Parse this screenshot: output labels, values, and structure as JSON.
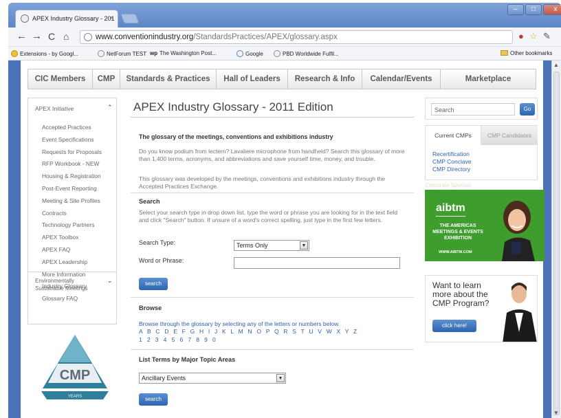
{
  "browser": {
    "tab_title": "APEX Industry Glossary - 201",
    "tab_close": "×",
    "url_domain": "www.conventionindustry.org",
    "url_path": "/StandardsPractices/APEX/glossary.aspx",
    "bookmarks": [
      "Extensions - by Googl...",
      "NetForum TEST",
      "The Washington Post...",
      "Google",
      "PBD Worldwide Fulfil..."
    ],
    "other_bookmarks": "Other bookmarks",
    "nav_icons": [
      "back-arrow",
      "forward-arrow",
      "reload",
      "home"
    ]
  },
  "topnav": {
    "items": [
      "CIC Members",
      "CMP",
      "Standards & Practices",
      "Hall of Leaders",
      "Research & Info",
      "Calendar/Events",
      "Marketplace"
    ]
  },
  "sidebar": {
    "heading": "APEX Initiative",
    "items": [
      "Accepted Practices",
      "Event Specifications",
      "Requests for Proposals",
      "RFP Workbook - NEW",
      "Housing & Registration",
      "Post-Event Reporting",
      "Meeting & Site Profiles",
      "Contracts",
      "Technology Partners",
      "APEX Toolbox",
      "APEX FAQ",
      "APEX Leadership",
      "More Information",
      "Industry Glossary",
      "Glossary FAQ"
    ],
    "env_line1": "Environmentally",
    "env_line2": "Sustainable Meetings"
  },
  "logo": {
    "text": "CMP",
    "ribbon": "YEARS"
  },
  "main": {
    "title": "APEX Industry Glossary - 2011 Edition",
    "intro_heading": "The glossary of the meetings, conventions and exhibitions industry",
    "intro_p1": "Do you know podium from lectern? Lavaliere microphone from handheld? Search this glossary of more than 1,400 terms, acronyms, and abbreviations and save yourself time, money, and trouble.",
    "intro_p2": "This glossary was developed by the meetings, conventions and exhibitions industry through the Accepted Practices Exchange.",
    "search_heading": "Search",
    "search_desc": "Select your search type in drop down list, type the word or phrase you are looking for in the text field and click \"Search\" button. If unsure of a word's correct spelling, just type in the first few letters.",
    "search_type_label": "Search Type:",
    "search_type_value": "Terms Only",
    "word_label": "Word or Phrase:",
    "search_button": "search",
    "browse_heading": "Browse",
    "browse_desc": "Browse through the glossary by selecting any of the letters or numbers below.",
    "letters": "A B C D E F G H I J K L M N O P Q R S T U V W X Y Z",
    "numbers": "1 2 3 4 5 6 7 8 9 0",
    "topic_heading": "List Terms by Major Topic Areas",
    "topic_value": "Ancillary Events",
    "topic_button": "search"
  },
  "right": {
    "search_placeholder": "Search",
    "go_label": "Go",
    "tab_current": "Current CMPs",
    "tab_candidates": "CMP Candidates",
    "links": [
      "Recertification",
      "CMP Conclave",
      "CMP Directory"
    ],
    "sponsor_label": "Corporate Sponsor",
    "ad1_logo": "aibtm",
    "ad1_tagline": "THE AMERICAS MEETINGS & EVENTS EXHIBITION",
    "ad1_url": "WWW.AIBTM.COM",
    "ad2_text": "Want to learn more about the CMP Program?",
    "ad2_button": "click here!"
  },
  "colors": {
    "link_blue": "#2f5fad",
    "button_blue": "#2d64b0",
    "ad_green": "#3f9d2e",
    "frame_blue": "#4a72b8"
  }
}
